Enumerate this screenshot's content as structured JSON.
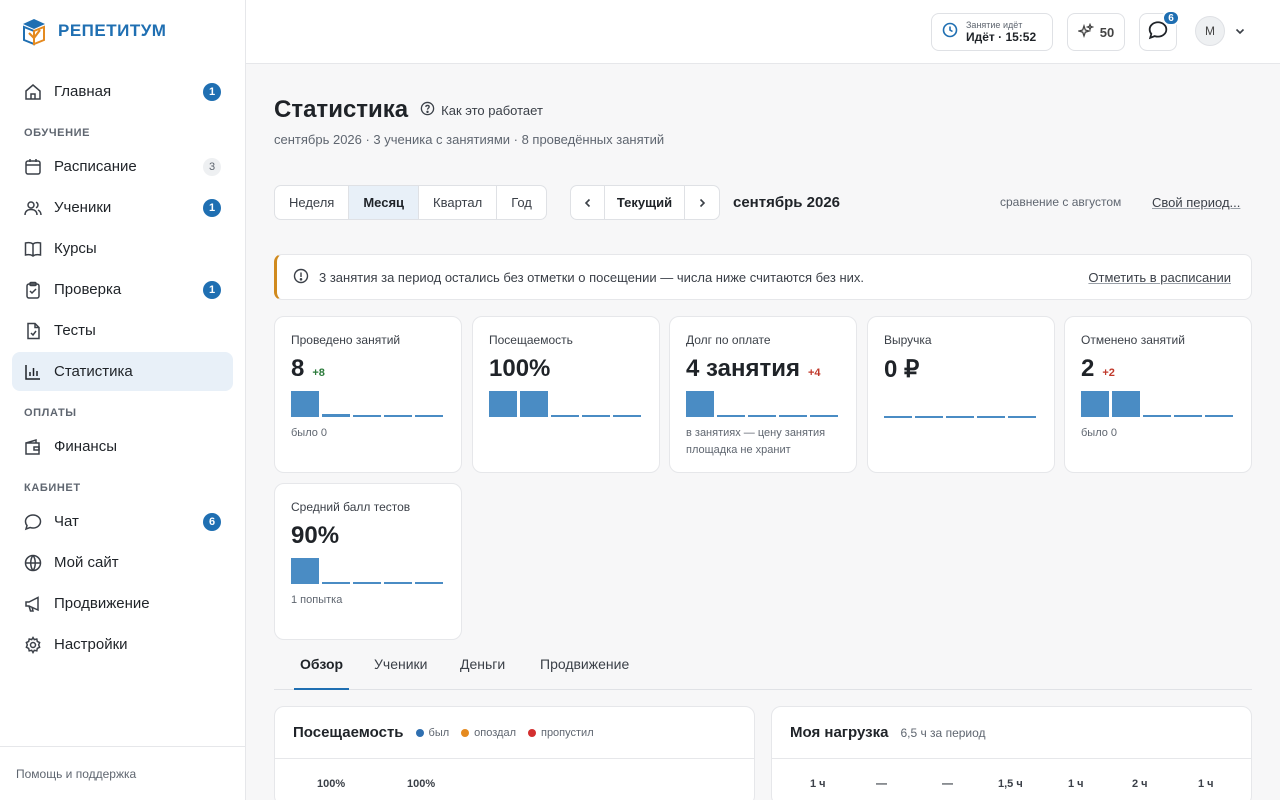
{
  "brand": {
    "name": "РЕПЕТИТУМ"
  },
  "sidebar": {
    "items": [
      {
        "label": "Главная",
        "icon": "home-icon",
        "badge": "1"
      },
      {
        "section": "ОБУЧЕНИЕ"
      },
      {
        "label": "Расписание",
        "icon": "calendar-icon",
        "badge": "3",
        "badge_style": "gray"
      },
      {
        "label": "Ученики",
        "icon": "users-icon",
        "badge": "1"
      },
      {
        "label": "Курсы",
        "icon": "book-icon"
      },
      {
        "label": "Проверка",
        "icon": "clipboard-icon",
        "badge": "1"
      },
      {
        "label": "Тесты",
        "icon": "file-check-icon"
      },
      {
        "label": "Статистика",
        "icon": "chart-icon",
        "active": true
      },
      {
        "section": "ОПЛАТЫ"
      },
      {
        "label": "Финансы",
        "icon": "wallet-icon"
      },
      {
        "section": "КАБИНЕТ"
      },
      {
        "label": "Чат",
        "icon": "chat-icon",
        "badge": "6"
      },
      {
        "label": "Мой сайт",
        "icon": "globe-icon"
      },
      {
        "label": "Продвижение",
        "icon": "megaphone-icon"
      },
      {
        "label": "Настройки",
        "icon": "gear-icon"
      }
    ],
    "footer": "Помощь и поддержка"
  },
  "topbar": {
    "lesson_small": "Занятие идёт",
    "lesson_big": "Идёт · 15:52",
    "score": "50",
    "chat_badge": "6",
    "avatar": "М"
  },
  "page": {
    "title": "Статистика",
    "how_it_works": "Как это работает",
    "subtitle": "сентябрь 2026 · 3 ученика с занятиями · 8 проведённых занятий",
    "ranges": [
      "Неделя",
      "Месяц",
      "Квартал",
      "Год"
    ],
    "active_range": "Месяц",
    "current": "Текущий",
    "period": "сентябрь 2026",
    "compare": "сравнение с августом",
    "custom_period": "Свой период..."
  },
  "alert": {
    "text": "3 занятия за период остались без отметки о посещении — числа ниже считаются без них.",
    "link": "Отметить в расписании"
  },
  "cards": [
    {
      "label": "Проведено занятий",
      "value": "8",
      "delta": "+8",
      "delta_type": "pos",
      "spark": [
        1,
        0.12,
        0,
        0,
        0
      ],
      "note": "было 0"
    },
    {
      "label": "Посещаемость",
      "value": "100%",
      "spark": [
        1,
        1,
        0,
        0,
        0
      ]
    },
    {
      "label": "Долг по оплате",
      "value": "4 занятия",
      "delta": "+4",
      "delta_type": "neg",
      "spark": [
        1,
        0,
        0,
        0,
        0
      ],
      "note": "в занятиях — цену занятия площадка не хранит"
    },
    {
      "label": "Выручка",
      "value": "0 ₽",
      "spark": [
        0,
        0,
        0,
        0,
        0
      ]
    },
    {
      "label": "Отменено занятий",
      "value": "2",
      "delta": "+2",
      "delta_type": "neg",
      "spark": [
        1,
        1,
        0,
        0,
        0
      ],
      "note": "было 0"
    },
    {
      "label": "Средний балл тестов",
      "value": "90%",
      "spark": [
        1,
        0,
        0,
        0,
        0
      ],
      "note": "1 попытка"
    }
  ],
  "tabs": [
    "Обзор",
    "Ученики",
    "Деньги",
    "Продвижение"
  ],
  "active_tab": "Обзор",
  "attendance_panel": {
    "title": "Посещаемость",
    "legend": [
      {
        "label": "был",
        "color": "#2f6fb0"
      },
      {
        "label": "опоздал",
        "color": "#e58a1f"
      },
      {
        "label": "пропустил",
        "color": "#d32f2f"
      }
    ],
    "values": [
      "100%",
      "100%"
    ]
  },
  "load_panel": {
    "title": "Моя нагрузка",
    "meta": "6,5 ч за период",
    "values": [
      "1 ч",
      "—",
      "—",
      "1,5 ч",
      "1 ч",
      "2 ч",
      "1 ч"
    ]
  },
  "colors": {
    "accent": "#1f6fb2",
    "bar": "#4a8cc4",
    "warning": "#d08a1e"
  }
}
